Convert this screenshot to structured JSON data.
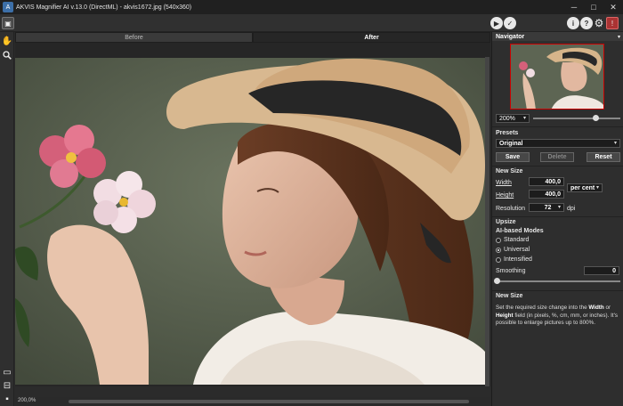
{
  "window": {
    "title": "AKVIS Magnifier AI v.13.0 (DirectML) - akvis1672.jpg (540x360)",
    "minimize": "─",
    "maximize": "□",
    "close": "✕"
  },
  "toolbar": {
    "open_icon": "▣",
    "run_icon": "▶",
    "apply_icon": "✓",
    "info_icon": "i",
    "help_icon": "?",
    "settings_icon": "⚙",
    "notify_icon": "!"
  },
  "tools": {
    "hand_icon": "✋",
    "zoom_icon": "🔍",
    "view1_icon": "▭",
    "view2_icon": "⊟",
    "view3_icon": "▪"
  },
  "tabs": {
    "before": "Before",
    "after": "After"
  },
  "status": {
    "zoom": "200,0%"
  },
  "navigator": {
    "title": "Navigator",
    "zoom": "200%",
    "zoom_fraction": 0.72
  },
  "presets": {
    "title": "Presets",
    "selected": "Original",
    "save": "Save",
    "delete": "Delete",
    "reset": "Reset"
  },
  "new_size": {
    "title": "New Size",
    "width_label": "Width",
    "width_value": "400,0",
    "height_label": "Height",
    "height_value": "400,0",
    "unit": "per cent",
    "resolution_label": "Resolution",
    "resolution_value": "72",
    "resolution_unit": "dpi"
  },
  "upsize": {
    "title": "Upsize",
    "modes_label": "AI-based Modes",
    "modes": [
      "Standard",
      "Universal",
      "Intensified"
    ],
    "selected_mode": 1,
    "smoothing_label": "Smoothing",
    "smoothing_value": "0"
  },
  "help": {
    "title": "New Size",
    "text_1": "Set the required size change into the ",
    "bold_1": "Width",
    "text_2": " or ",
    "bold_2": "Height",
    "text_3": " field (in pixels, %, cm, mm, or inches). It's possible to enlarge pictures up to 800%."
  }
}
